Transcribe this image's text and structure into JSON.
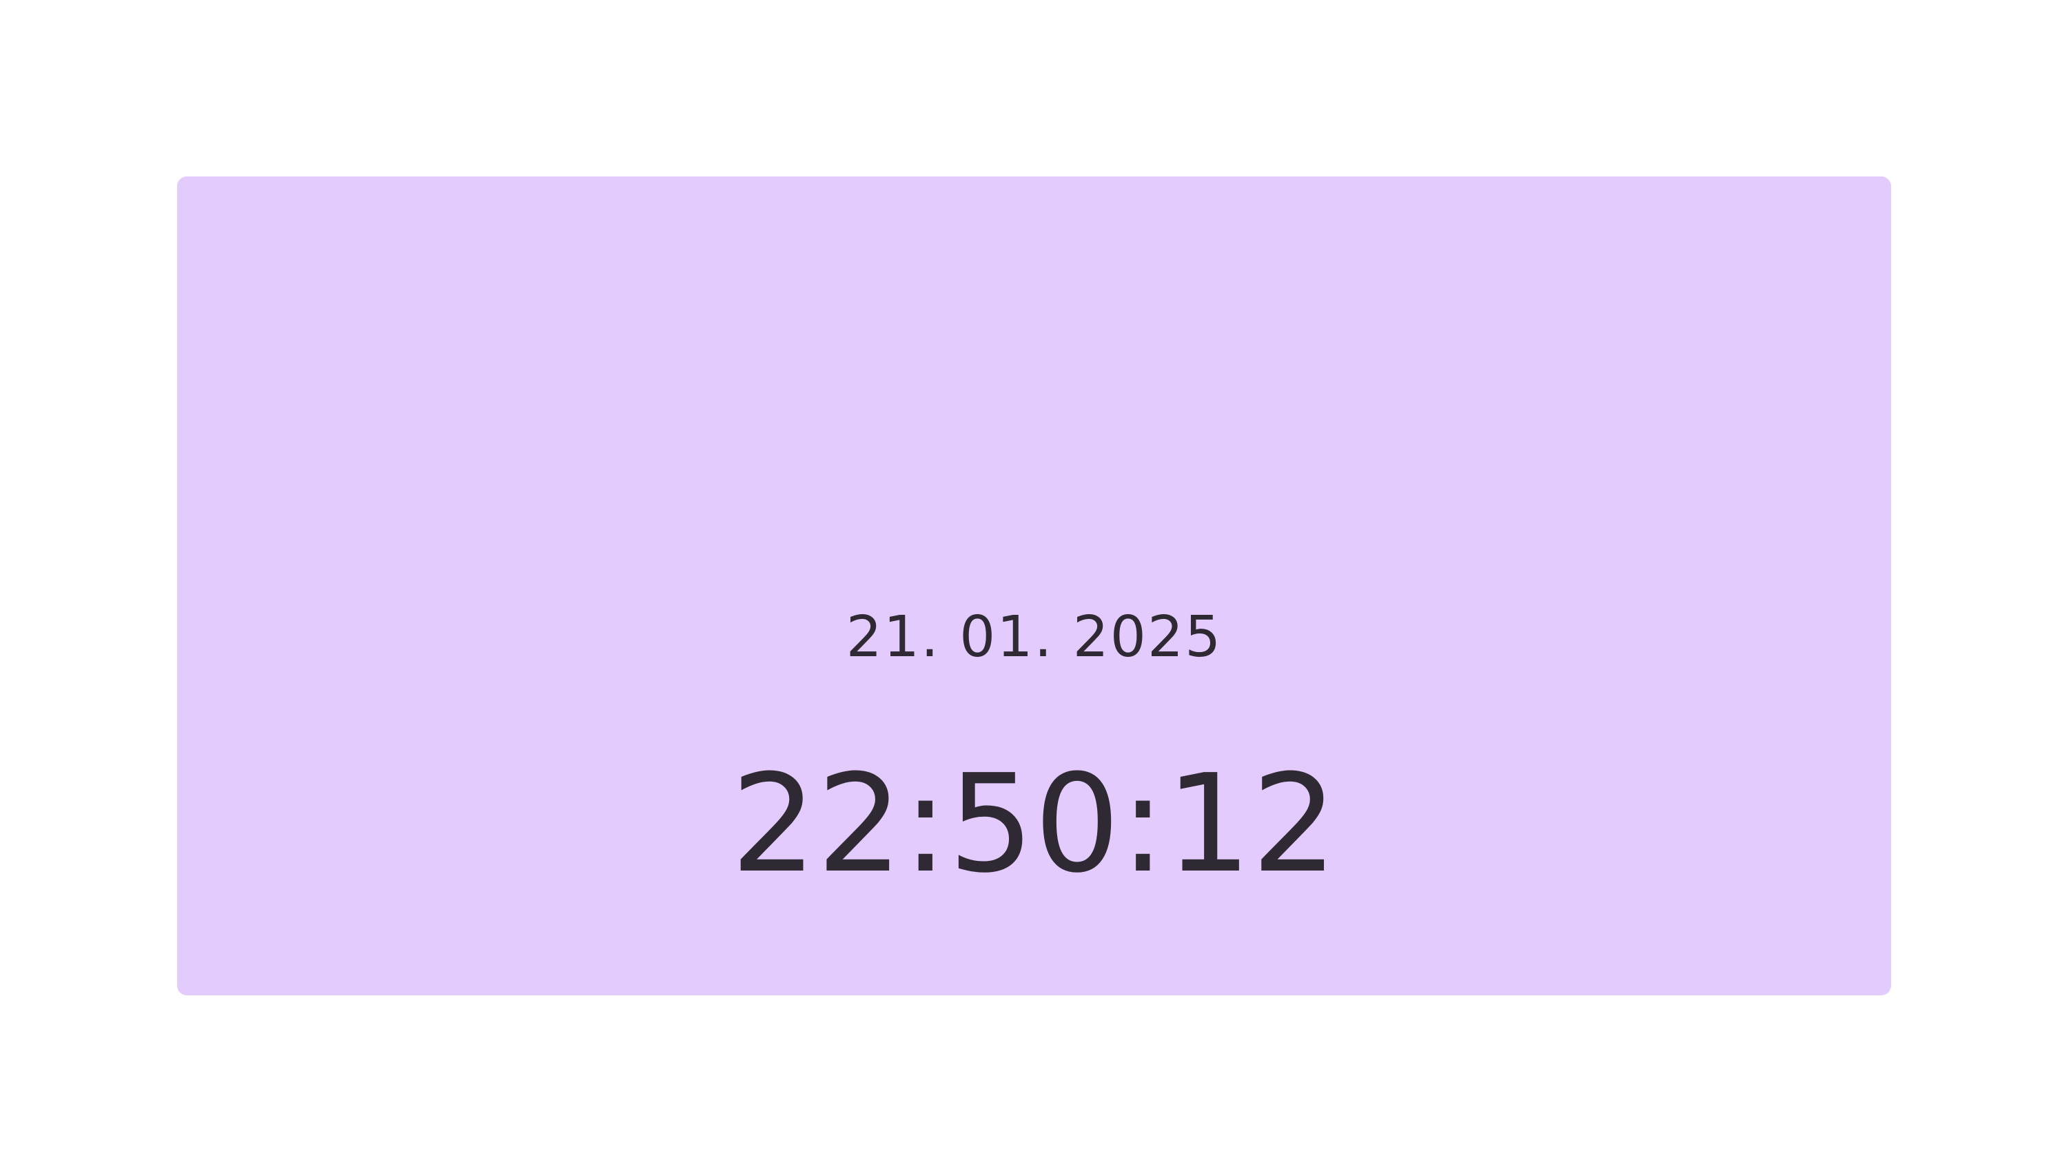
{
  "clock": {
    "date": "21. 01. 2025",
    "time": "22:50:12"
  },
  "colors": {
    "background": "#ffffff",
    "card": "#e3cbfd",
    "text": "#2f2933"
  }
}
